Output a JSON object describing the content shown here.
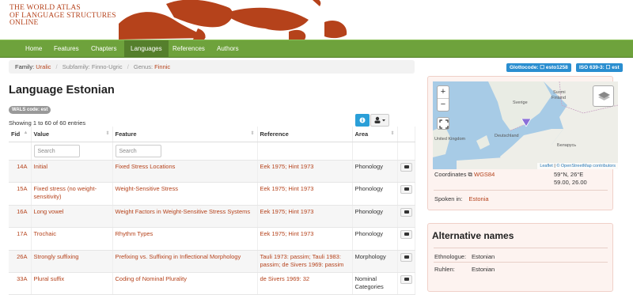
{
  "header": {
    "logo_lines": [
      "THE WORLD ATLAS",
      "OF LANGUAGE STRUCTURES",
      "ONLINE"
    ]
  },
  "nav": {
    "items": [
      "Home",
      "Features",
      "Chapters",
      "Languages",
      "References",
      "Authors"
    ],
    "active": "Languages"
  },
  "breadcrumb": {
    "family_label": "Family:",
    "family": "Uralic",
    "subfamily_label": "Subfamily:",
    "subfamily": "Finno-Ugric",
    "genus_label": "Genus:",
    "genus": "Finnic"
  },
  "badges": {
    "glottocode": "Glottocode: ☐ esto1258",
    "iso": "ISO 639-3: ☐ est"
  },
  "page": {
    "title": "Language Estonian",
    "wals_code": "WALS code: est",
    "entries_info": "Showing 1 to 60 of 60 entries"
  },
  "table": {
    "columns": [
      "Fid",
      "Value",
      "Feature",
      "Reference",
      "Area"
    ],
    "search_placeholder": "Search",
    "rows": [
      {
        "fid": "14A",
        "value": "Initial",
        "feature": "Fixed Stress Locations",
        "reference": "Eek 1975; Hint 1973",
        "area": "Phonology"
      },
      {
        "fid": "15A",
        "value": "Fixed stress (no weight-sensitivity)",
        "feature": "Weight-Sensitive Stress",
        "reference": "Eek 1975; Hint 1973",
        "area": "Phonology"
      },
      {
        "fid": "16A",
        "value": "Long vowel",
        "feature": "Weight Factors in Weight-Sensitive Stress Systems",
        "reference": "Eek 1975; Hint 1973",
        "area": "Phonology"
      },
      {
        "fid": "17A",
        "value": "Trochaic",
        "feature": "Rhythm Types",
        "reference": "Eek 1975; Hint 1973",
        "area": "Phonology"
      },
      {
        "fid": "26A",
        "value": "Strongly suffixing",
        "feature": "Prefixing vs. Suffixing in Inflectional Morphology",
        "reference": "Tauli 1973: passim; Tauli 1983: passim; de Sivers 1969: passim",
        "area": "Morphology"
      },
      {
        "fid": "33A",
        "value": "Plural suffix",
        "feature": "Coding of Nominal Plurality",
        "reference": "de Sivers 1969: 32",
        "area": "Nominal Categories"
      }
    ]
  },
  "map": {
    "zoom_in": "+",
    "zoom_out": "−",
    "labels": [
      "Suomi",
      "Finland",
      "Sverige",
      "United Kingdom",
      "Deutschland",
      "Беларусь"
    ],
    "attribution_leaflet": "Leaflet",
    "attribution_osm": "© OpenStreetMap contributors"
  },
  "info": {
    "coordinates_label": "Coordinates",
    "coordinates_link": "WGS84",
    "coord_dms": "59°N, 26°E",
    "coord_decimal": "59.00, 26.00",
    "spoken_label": "Spoken in:",
    "spoken_value": "Estonia"
  },
  "alternative_names": {
    "title": "Alternative names",
    "rows": [
      {
        "source": "Ethnologue:",
        "name": "Estonian"
      },
      {
        "source": "Ruhlen:",
        "name": "Estonian"
      }
    ]
  },
  "colors": {
    "brand": "#b5421b",
    "nav": "#6ea23c",
    "badge": "#2a8ed0"
  }
}
